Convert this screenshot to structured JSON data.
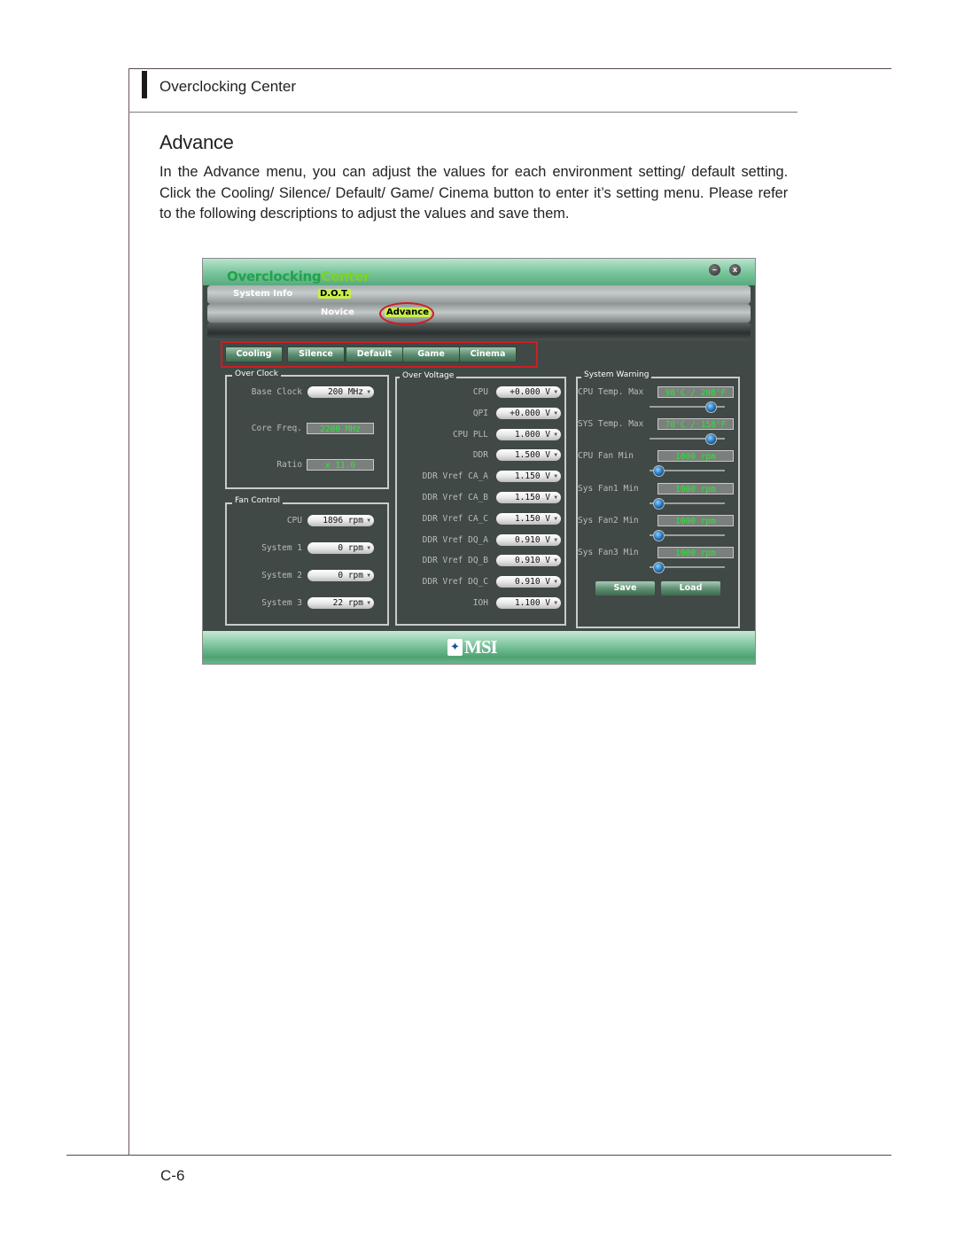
{
  "document": {
    "section_title": "Overclocking Center",
    "heading": "Advance",
    "paragraph": "In the Advance menu, you can adjust the values for each environment setting/ default setting. Click the Cooling/ Silence/ Default/ Game/ Cinema button to enter it’s setting menu. Please refer to the following descriptions to adjust the values and save them.",
    "page_number": "C-6"
  },
  "app": {
    "title_part1": "Overclocking",
    "title_part2": "Center",
    "window_controls": {
      "minimize_icon": "minimize-icon",
      "close_icon": "close-icon",
      "close_glyph": "x",
      "minimize_glyph": "–"
    },
    "nav_row1": [
      "System Info",
      "D.O.T."
    ],
    "nav_row2": [
      "Novice",
      "Advance"
    ],
    "active_nav": "Advance",
    "presets": [
      "Cooling",
      "Silence",
      "Default",
      "Game",
      "Cinema"
    ],
    "highlight_color": "#d01c24",
    "over_clock": {
      "title": "Over Clock",
      "rows": [
        {
          "label": "Base Clock",
          "value": "200 MHz",
          "type": "dropdown"
        },
        {
          "label": "Core Freq.",
          "value": "2200 MHz",
          "type": "readonly"
        },
        {
          "label": "Ratio",
          "value": "x 11.0",
          "type": "readonly"
        }
      ]
    },
    "fan_control": {
      "title": "Fan Control",
      "rows": [
        {
          "label": "CPU",
          "value": "1896 rpm"
        },
        {
          "label": "System 1",
          "value": "0 rpm"
        },
        {
          "label": "System 2",
          "value": "0 rpm"
        },
        {
          "label": "System 3",
          "value": "22 rpm"
        }
      ]
    },
    "over_voltage": {
      "title": "Over Voltage",
      "rows": [
        {
          "label": "CPU",
          "value": "+0.000 V"
        },
        {
          "label": "QPI",
          "value": "+0.000 V"
        },
        {
          "label": "CPU PLL",
          "value": "1.000 V"
        },
        {
          "label": "DDR",
          "value": "1.500 V"
        },
        {
          "label": "DDR Vref CA_A",
          "value": "1.150 V"
        },
        {
          "label": "DDR Vref CA_B",
          "value": "1.150 V"
        },
        {
          "label": "DDR Vref CA_C",
          "value": "1.150 V"
        },
        {
          "label": "DDR Vref DQ_A",
          "value": "0.910 V"
        },
        {
          "label": "DDR Vref DQ_B",
          "value": "0.910 V"
        },
        {
          "label": "DDR Vref DQ_C",
          "value": "0.910 V"
        },
        {
          "label": "IOH",
          "value": "1.100 V"
        }
      ]
    },
    "system_warning": {
      "title": "System Warning",
      "rows": [
        {
          "label": "CPU Temp. Max",
          "value": "98'C / 208'F",
          "slider_fraction": 0.85
        },
        {
          "label": "SYS Temp. Max",
          "value": "70'C / 158'F",
          "slider_fraction": 0.85
        },
        {
          "label": "CPU Fan Min",
          "value": "1000 rpm",
          "slider_fraction": 0.05
        },
        {
          "label": "Sys Fan1 Min",
          "value": "1000 rpm",
          "slider_fraction": 0.05
        },
        {
          "label": "Sys Fan2 Min",
          "value": "1000 rpm",
          "slider_fraction": 0.05
        },
        {
          "label": "Sys Fan3 Min",
          "value": "1000 rpm",
          "slider_fraction": 0.05
        }
      ],
      "save_label": "Save",
      "load_label": "Load"
    },
    "footer_logo": "MSI"
  }
}
